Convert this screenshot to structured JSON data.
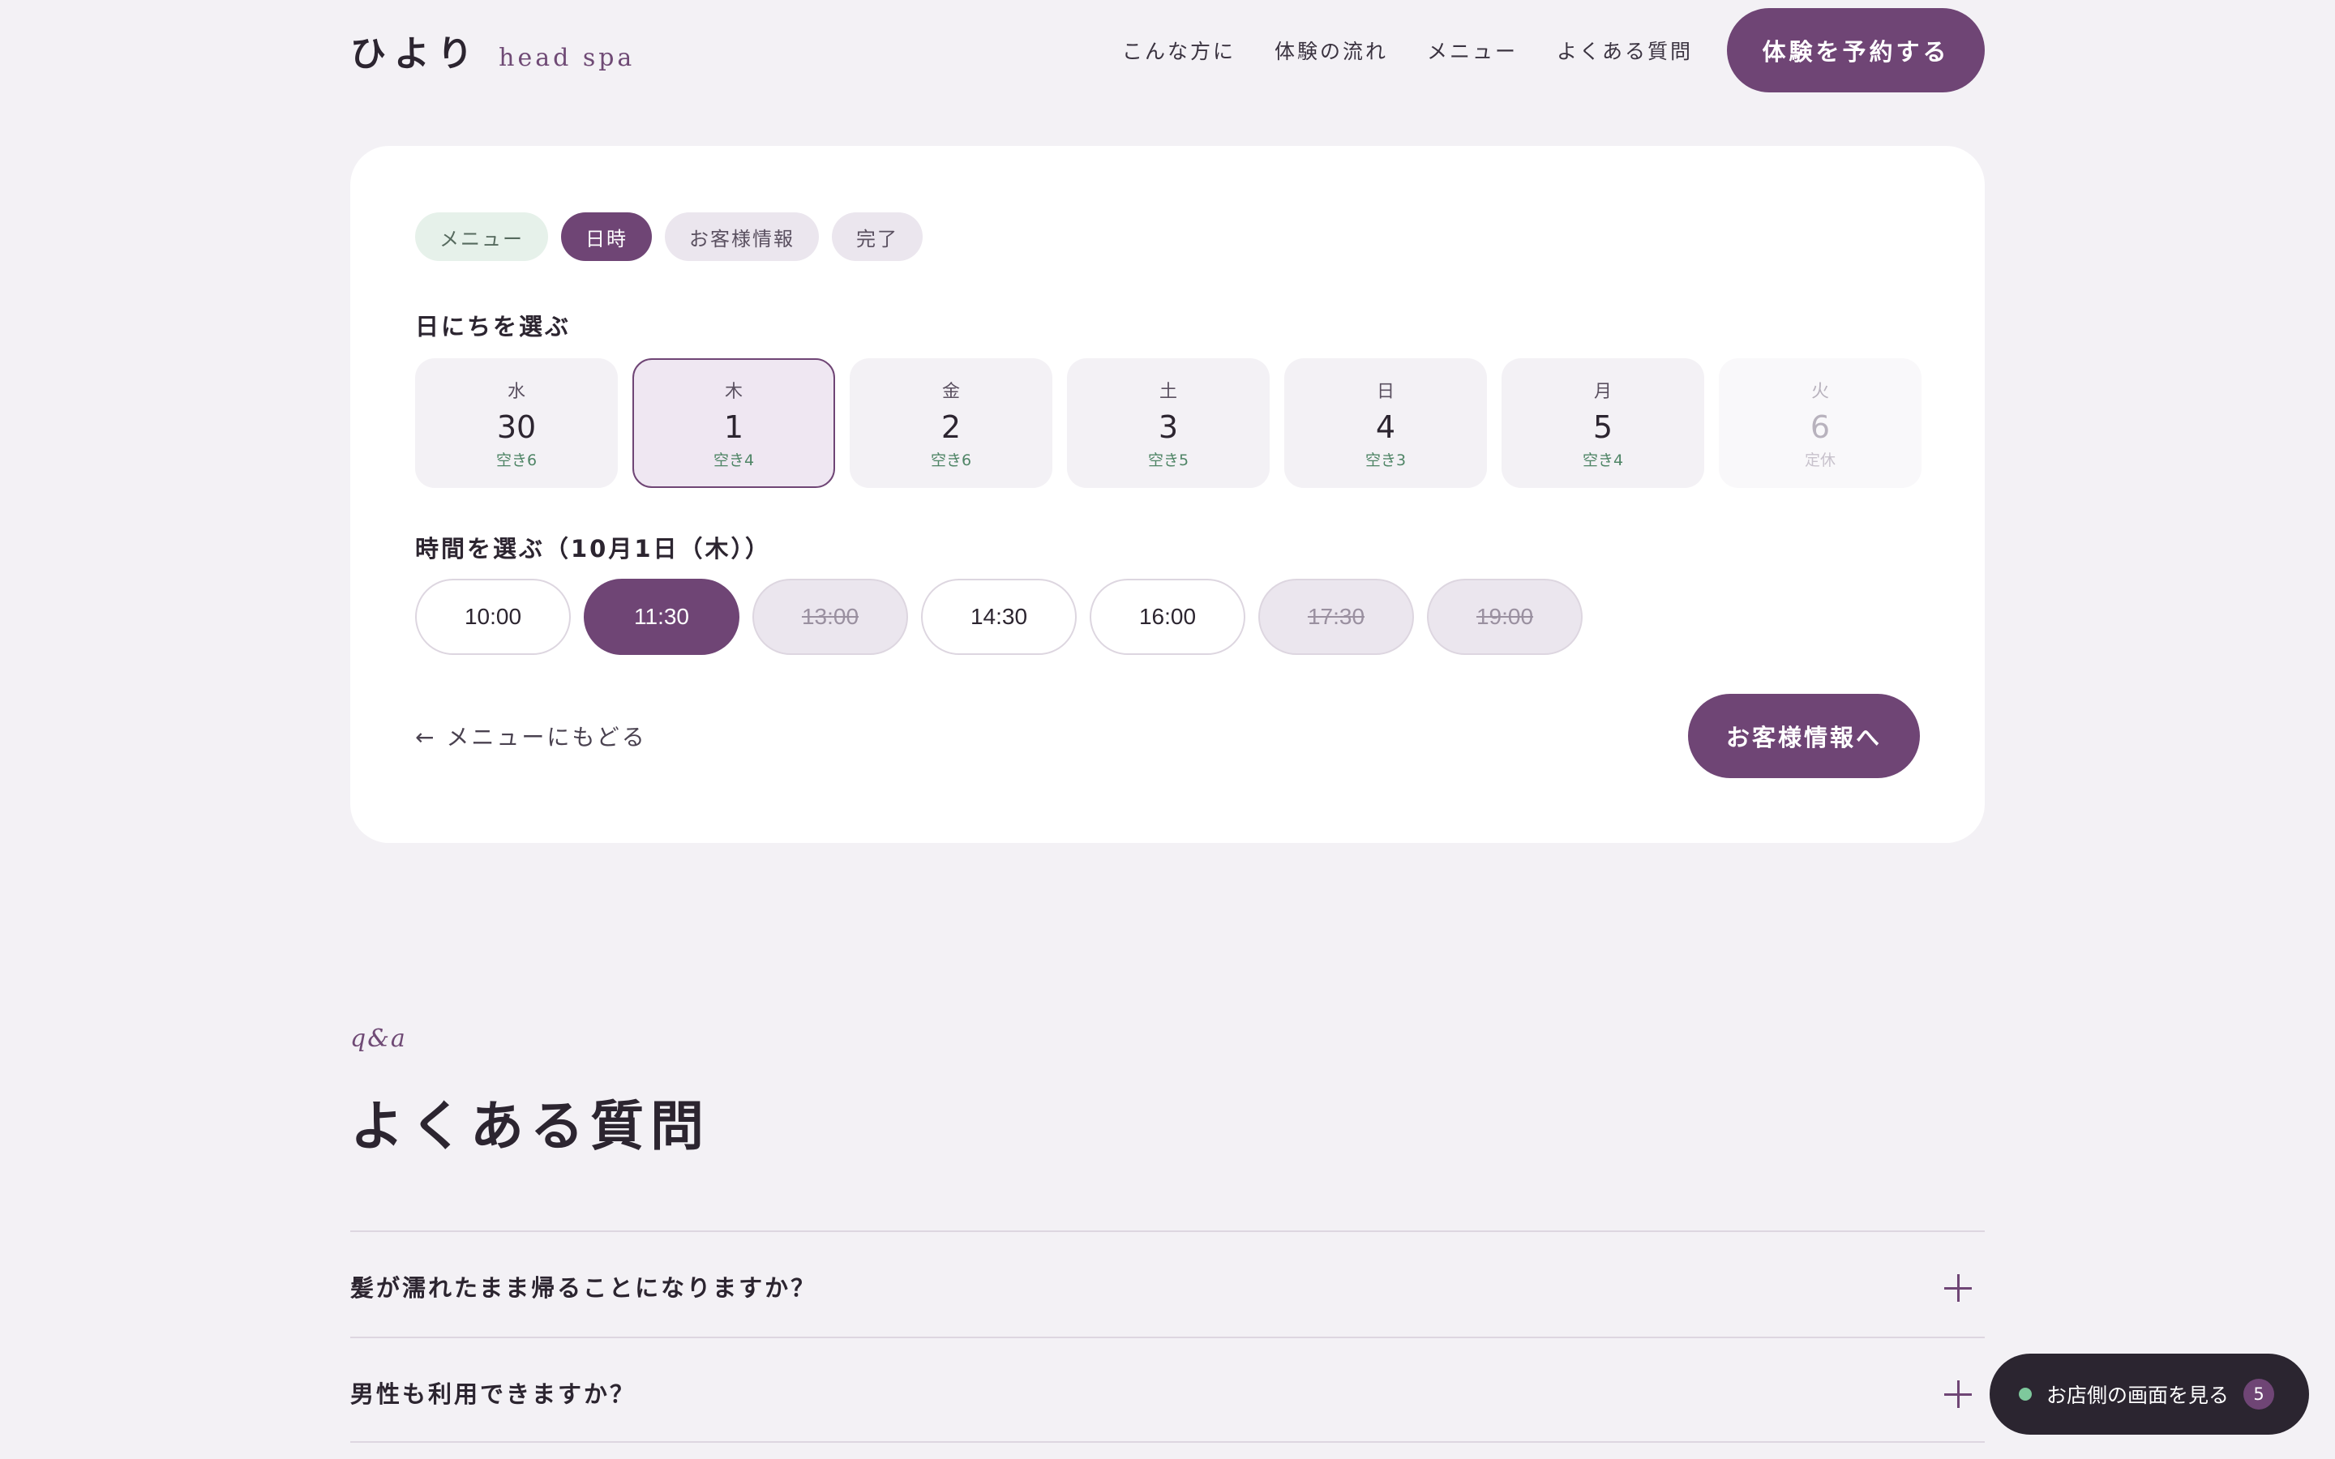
{
  "header": {
    "logo_main": "ひより",
    "logo_sub": "head spa",
    "nav": [
      "こんな方に",
      "体験の流れ",
      "メニュー",
      "よくある質問"
    ],
    "cta": "体験を予約する"
  },
  "booking": {
    "steps": [
      {
        "label": "メニュー",
        "state": "done"
      },
      {
        "label": "日時",
        "state": "active"
      },
      {
        "label": "お客様情報",
        "state": "pending"
      },
      {
        "label": "完了",
        "state": "pending"
      }
    ],
    "day_section_label": "日にちを選ぶ",
    "days": [
      {
        "dow": "水",
        "num": "30",
        "avail": "空き6",
        "state": "normal"
      },
      {
        "dow": "木",
        "num": "1",
        "avail": "空き4",
        "state": "selected"
      },
      {
        "dow": "金",
        "num": "2",
        "avail": "空き6",
        "state": "normal"
      },
      {
        "dow": "土",
        "num": "3",
        "avail": "空き5",
        "state": "normal"
      },
      {
        "dow": "日",
        "num": "4",
        "avail": "空き3",
        "state": "normal"
      },
      {
        "dow": "月",
        "num": "5",
        "avail": "空き4",
        "state": "normal"
      },
      {
        "dow": "火",
        "num": "6",
        "avail": "定休",
        "state": "closed"
      }
    ],
    "time_section_label": "時間を選ぶ（10月1日（木））",
    "times": [
      {
        "label": "10:00",
        "state": "open"
      },
      {
        "label": "11:30",
        "state": "selected"
      },
      {
        "label": "13:00",
        "state": "full"
      },
      {
        "label": "14:30",
        "state": "open"
      },
      {
        "label": "16:00",
        "state": "open"
      },
      {
        "label": "17:30",
        "state": "full"
      },
      {
        "label": "19:00",
        "state": "full"
      }
    ],
    "back_label": "← メニューにもどる",
    "next_label": "お客様情報へ"
  },
  "faq": {
    "eyebrow": "q&a",
    "title": "よくある質問",
    "items": [
      "髪が濡れたまま帰ることになりますか？",
      "男性も利用できますか？"
    ]
  },
  "float": {
    "label": "お店側の画面を見る",
    "badge": "5"
  },
  "colors": {
    "accent": "#6f4575",
    "background": "#f3f1f5",
    "available": "#4f8566",
    "status_dot": "#7ec89c"
  }
}
